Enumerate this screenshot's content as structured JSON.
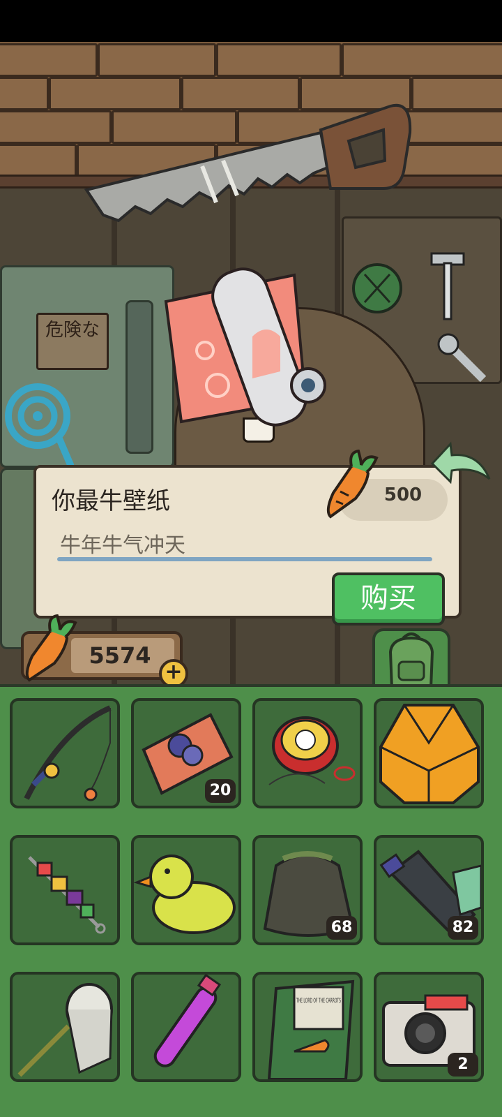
{
  "shop_dialog": {
    "item_name": "你最牛壁纸",
    "item_description": "牛年牛气冲天",
    "price": "500",
    "buy_label": "购买"
  },
  "sign_text": "危険な",
  "wallet": {
    "carrots": "5574",
    "add_symbol": "+"
  },
  "inventory": {
    "items": [
      {
        "name": "fishing-rod",
        "count": ""
      },
      {
        "name": "collection-ticket",
        "count": "20"
      },
      {
        "name": "yoyo",
        "count": ""
      },
      {
        "name": "origami-fortune-teller",
        "count": ""
      },
      {
        "name": "vegetable-skewer",
        "count": ""
      },
      {
        "name": "rubber-duck",
        "count": ""
      },
      {
        "name": "old-sack",
        "count": "68"
      },
      {
        "name": "plastic-bottle",
        "count": "82"
      },
      {
        "name": "bug-net",
        "count": ""
      },
      {
        "name": "potion-vial",
        "count": ""
      },
      {
        "name": "book-lord-of-the-carrots",
        "count": ""
      },
      {
        "name": "instant-camera",
        "count": "2"
      }
    ]
  },
  "book_title": "THE LORD OF THE CARROTS",
  "colors": {
    "buy_button": "#4fc062",
    "inventory_bg": "#4e8f4a",
    "dialog_bg": "#ece3cf"
  }
}
